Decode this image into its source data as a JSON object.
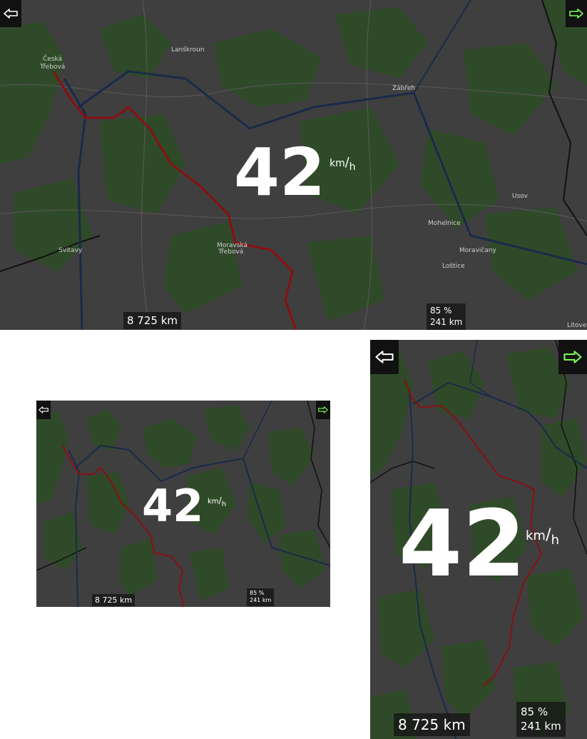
{
  "speed": {
    "value": "42",
    "unit_top": "km",
    "unit_slash": "/",
    "unit_bottom": "h"
  },
  "odometer": "8 725 km",
  "battery": "85 %",
  "range": "241 km",
  "places": [
    "Česká",
    "Třebová",
    "Lanškroun",
    "Zábřeh",
    "Usov",
    "Svitavy",
    "Moravská",
    "Třebová",
    "Mohelnice",
    "Moravičany",
    "Loštice",
    "Litovel"
  ],
  "colors": {
    "map_bg": "#3f3f3f",
    "forest": "#2f4a28",
    "route": "#8b1010",
    "highway": "#1a2a4a",
    "next_arrow": "#7cff5a",
    "prev_arrow": "#ffffff"
  },
  "icons": {
    "prev": "arrow-left-icon",
    "next": "arrow-right-icon"
  }
}
